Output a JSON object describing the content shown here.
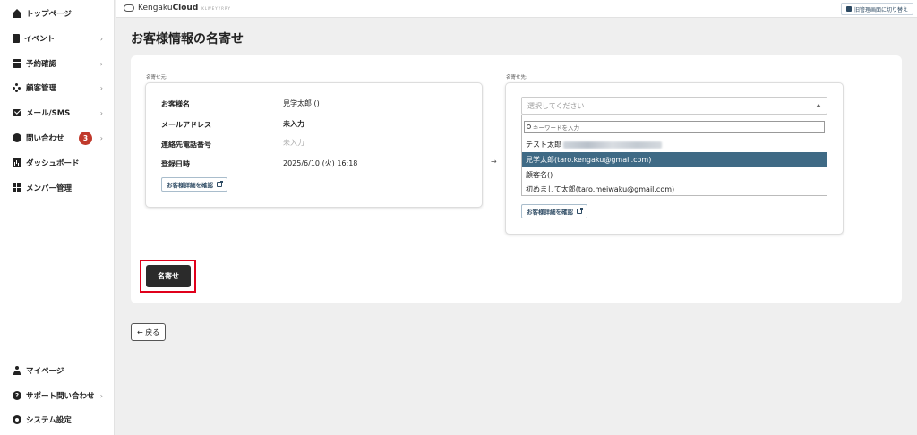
{
  "sidebar": {
    "items": [
      {
        "label": "トップページ",
        "icon": "home-icon",
        "chevron": ""
      },
      {
        "label": "イベント",
        "icon": "document-icon",
        "chevron": "›"
      },
      {
        "label": "予約確認",
        "icon": "calendar-icon",
        "chevron": "›"
      },
      {
        "label": "顧客管理",
        "icon": "people-icon",
        "chevron": "›"
      },
      {
        "label": "メール/SMS",
        "icon": "mail-icon",
        "chevron": "›"
      },
      {
        "label": "問い合わせ",
        "icon": "inquiry-icon",
        "chevron": "›",
        "badge": "3"
      },
      {
        "label": "ダッシュボード",
        "icon": "chart-icon",
        "chevron": ""
      },
      {
        "label": "メンバー管理",
        "icon": "grid-icon",
        "chevron": ""
      }
    ],
    "bottom_items": [
      {
        "label": "マイページ",
        "icon": "user-icon",
        "chevron": ""
      },
      {
        "label": "サポート問い合わせ",
        "icon": "help-icon",
        "chevron": "›"
      },
      {
        "label": "システム設定",
        "icon": "gear-icon",
        "chevron": ""
      }
    ]
  },
  "topbar": {
    "logo_main": "Kengaku",
    "logo_bold": "Cloud",
    "logo_sub": "KLWEYYRRY",
    "switch_label": "旧管理画面に切り替え"
  },
  "page": {
    "title": "お客様情報の名寄せ"
  },
  "source": {
    "section_label": "名寄せ元:",
    "fields": [
      {
        "label": "お客様名",
        "value": "見学太郎 ()",
        "muted": false
      },
      {
        "label": "メールアドレス",
        "value": "未入力",
        "muted": false
      },
      {
        "label": "連絡先電話番号",
        "value": "未入力",
        "muted": true
      },
      {
        "label": "登録日時",
        "value": "2025/6/10 (火) 16:18",
        "muted": false
      }
    ],
    "detail_button": "お客様詳細を確認"
  },
  "arrow": "→",
  "target": {
    "section_label": "名寄せ先:",
    "select_placeholder": "選択してください",
    "search_placeholder": "キーワードを入力",
    "options": [
      {
        "label": "テスト太郎",
        "blurred": true,
        "selected": false
      },
      {
        "label": "見学太郎(taro.kengaku@gmail.com)",
        "blurred": false,
        "selected": true
      },
      {
        "label": "顧客名()",
        "blurred": false,
        "selected": false
      },
      {
        "label": "初めまして太郎(taro.meiwaku@gmail.com)",
        "blurred": false,
        "selected": false
      }
    ],
    "detail_button": "お客様詳細を確認"
  },
  "actions": {
    "merge_label": "名寄せ",
    "back_label": "← 戻る"
  },
  "colors": {
    "selected_option": "#3f6a85",
    "highlight": "#e0001b",
    "badge": "#c0392b",
    "primary_button": "#2b2b2b"
  }
}
